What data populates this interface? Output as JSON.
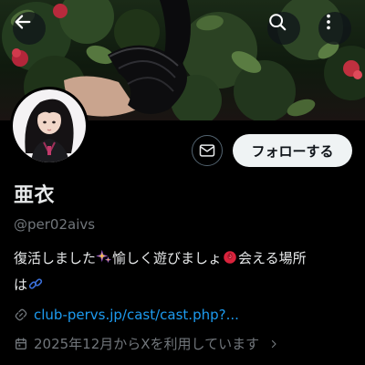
{
  "header": {
    "back_icon": "arrow-left-icon",
    "search_icon": "search-icon",
    "more_icon": "more-vertical-icon"
  },
  "profile": {
    "display_name": "亜衣",
    "handle": "@per02aivs",
    "bio": {
      "part1": "復活しました",
      "part2": "愉しく遊びましょ",
      "part3": "会える場所",
      "part4": "は",
      "emojis": [
        "sparkles-icon",
        "rose-icon",
        "link-icon"
      ]
    },
    "website": "club-pervs.jp/cast/cast.php?...",
    "joined": "2025年12月からXを利用しています"
  },
  "actions": {
    "follow_label": "フォローする",
    "message_icon": "envelope-icon"
  },
  "colors": {
    "background": "#000000",
    "text_primary": "#e7e9ea",
    "text_secondary": "#71767b",
    "link": "#1d9bf0",
    "follow_button_bg": "#eff3f4",
    "follow_button_text": "#0f1419"
  }
}
